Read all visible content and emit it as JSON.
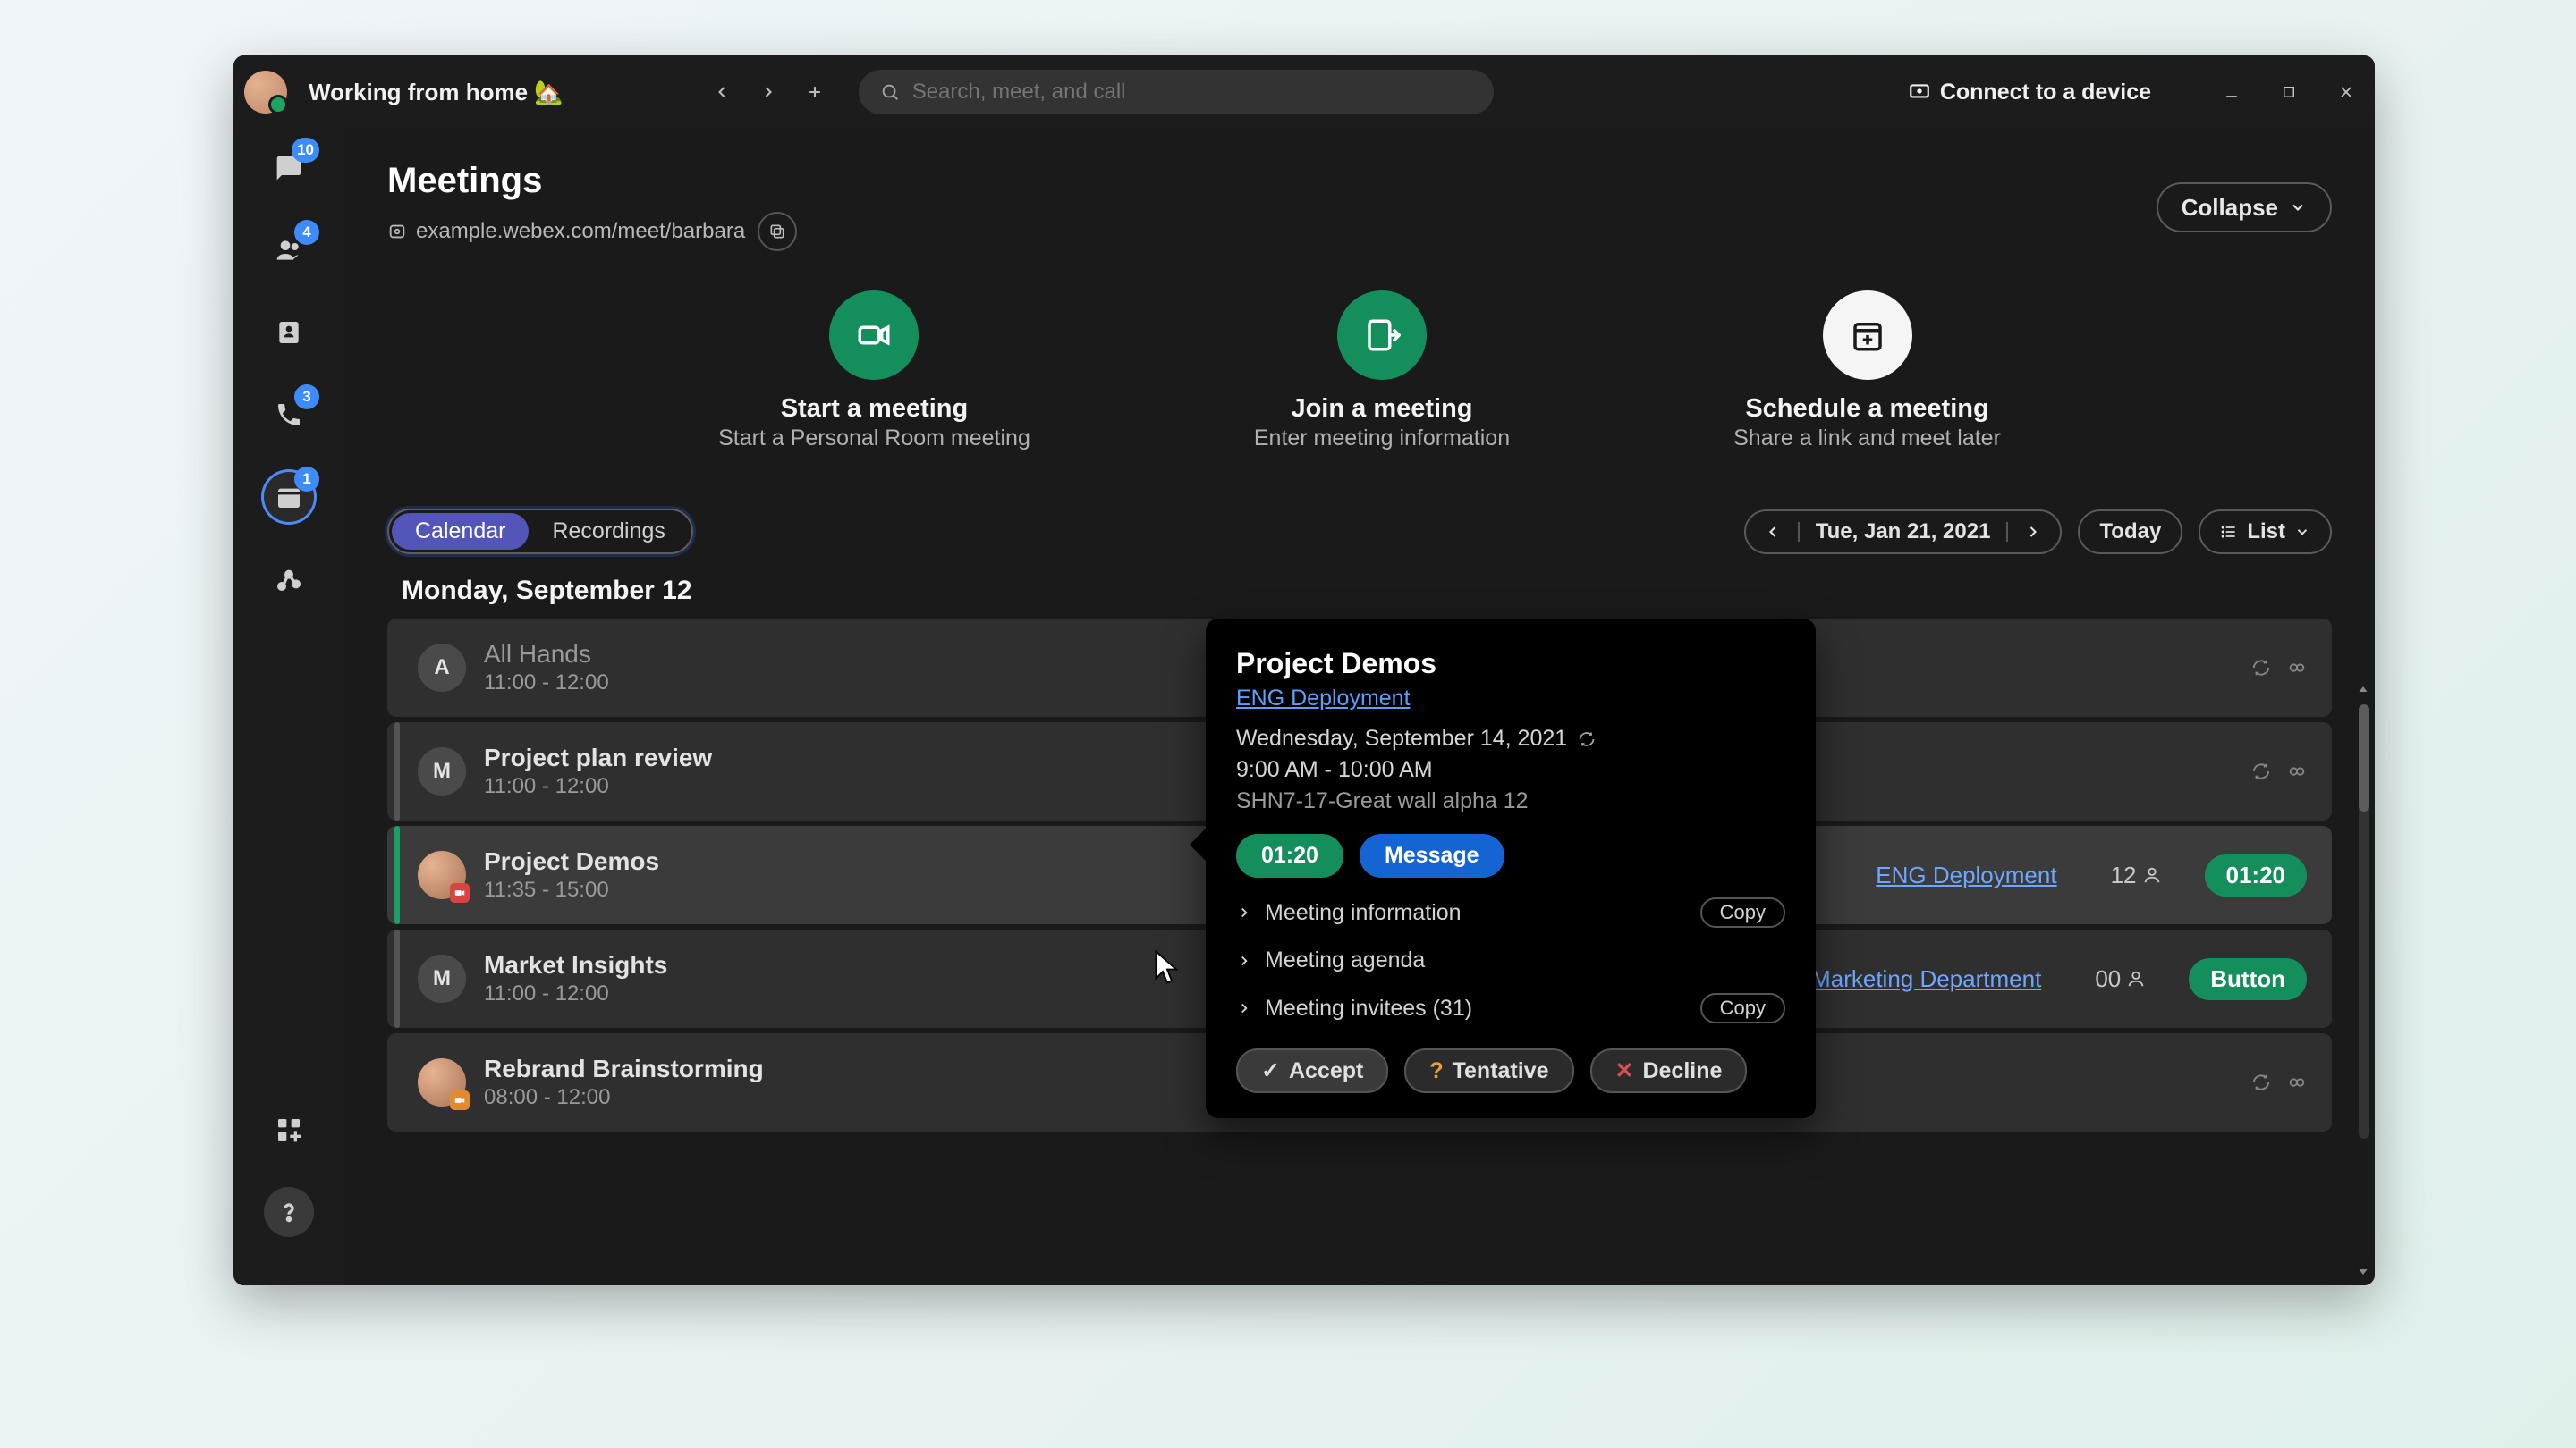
{
  "titlebar": {
    "status": "Working from home 🏡",
    "search_placeholder": "Search, meet, and call",
    "connect_device": "Connect to a device"
  },
  "rail": {
    "items": [
      {
        "id": "messaging",
        "icon": "chat",
        "badge": "10"
      },
      {
        "id": "teams",
        "icon": "people",
        "badge": "4"
      },
      {
        "id": "contacts",
        "icon": "contact-card",
        "badge": null
      },
      {
        "id": "calling",
        "icon": "phone",
        "badge": "3"
      },
      {
        "id": "meetings",
        "icon": "calendar",
        "badge": "1",
        "active": true
      },
      {
        "id": "activity",
        "icon": "activity",
        "badge": null
      }
    ],
    "bottom": [
      {
        "id": "apps",
        "icon": "apps"
      },
      {
        "id": "help",
        "icon": "help"
      }
    ]
  },
  "header": {
    "title": "Meetings",
    "room_url": "example.webex.com/meet/barbara",
    "collapse_label": "Collapse"
  },
  "actions": [
    {
      "title": "Start a meeting",
      "subtitle": "Start a Personal Room meeting",
      "style": "green",
      "icon": "video"
    },
    {
      "title": "Join a meeting",
      "subtitle": "Enter meeting information",
      "style": "green",
      "icon": "join"
    },
    {
      "title": "Schedule a meeting",
      "subtitle": "Share a link and meet later",
      "style": "white",
      "icon": "schedule"
    }
  ],
  "toolbar": {
    "segments": [
      {
        "label": "Calendar",
        "active": true
      },
      {
        "label": "Recordings",
        "active": false
      }
    ],
    "date_label": "Tue, Jan 21, 2021",
    "today_label": "Today",
    "view_label": "List"
  },
  "list": {
    "day_header": "Monday, September 12",
    "rows": [
      {
        "initial": "A",
        "title": "All Hands",
        "time": "11:00 - 12:00",
        "dim": true,
        "icons": true
      },
      {
        "initial": "M",
        "title": "Project plan review",
        "time": "11:00 - 12:00",
        "icons": true
      },
      {
        "photo": true,
        "cam": "red",
        "title": "Project Demos",
        "time": "11:35 - 15:00",
        "selected": true,
        "link": "ENG Deployment",
        "count": "12",
        "pill": "01:20"
      },
      {
        "initial": "M",
        "title": "Market Insights",
        "time": "11:00 - 12:00",
        "link": "Marketing Department",
        "count": "00",
        "button": "Button"
      },
      {
        "photo": true,
        "cam": "orange",
        "title": "Rebrand Brainstorming",
        "time": "08:00 - 12:00",
        "icons": true
      }
    ]
  },
  "popover": {
    "title": "Project Demos",
    "link": "ENG Deployment",
    "date": "Wednesday, September 14, 2021",
    "time": "9:00 AM - 10:00 AM",
    "location": "SHN7-17-Great wall alpha 12",
    "join_pill": "01:20",
    "message_btn": "Message",
    "expanders": [
      {
        "label": "Meeting information",
        "copy": "Copy"
      },
      {
        "label": "Meeting agenda"
      },
      {
        "label": "Meeting invitees (31)",
        "copy": "Copy"
      }
    ],
    "rsvp": {
      "accept": "Accept",
      "tentative": "Tentative",
      "decline": "Decline"
    }
  }
}
